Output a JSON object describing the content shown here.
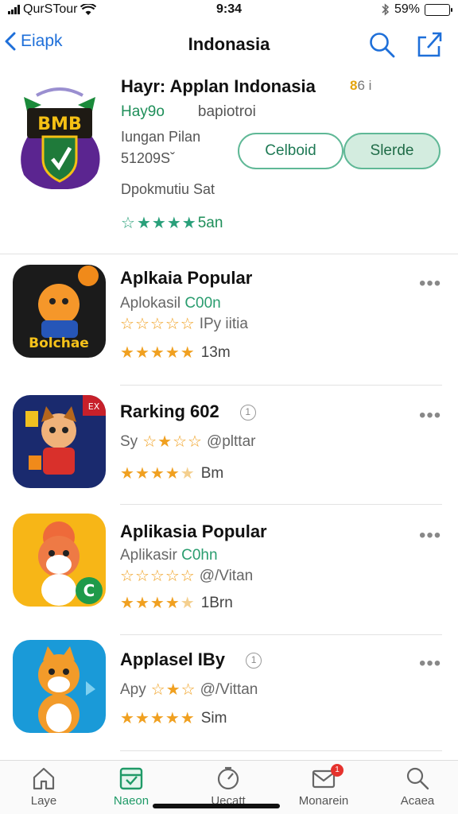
{
  "status_bar": {
    "carrier": "QurSTour",
    "time": "9:34",
    "battery": "59%",
    "battery_level": 0.59
  },
  "nav": {
    "back_label": "Eiapk",
    "title": "Indonasia"
  },
  "featured": {
    "title": "Hayr: Applan Indonasia",
    "badge_num": "8",
    "badge_text": "6 i",
    "developer": "Hay9o",
    "developer_sub": "bapiotroi",
    "meta_line1": "Iungan Pilan",
    "meta_line2": "51209Sˇ",
    "button_outline": "Celboid",
    "button_filled": "Slerde",
    "description": "Dpokmutiu  Sat",
    "rating_text": "5an",
    "rating_stars": 4
  },
  "items": [
    {
      "name": "Aplkaia Popular",
      "sub_prefix": "Aplokasil",
      "sub_accent": "C00n",
      "sub_stars_text": "IPy iitia",
      "rating_count": "13m",
      "stars": 5,
      "icon_text": "Bolchae"
    },
    {
      "name": "Rarking 602",
      "info": "1",
      "sub_prefix": "Sy",
      "sub_stars_text": "@plttar",
      "rating_count": "Bm",
      "stars": 4,
      "icon_badge": "EX"
    },
    {
      "name": "Aplikasia Popular",
      "sub_prefix": "Aplikasir",
      "sub_accent": "C0hn",
      "sub_stars_text": "@/Vitan",
      "rating_count": "1Brn",
      "stars": 4,
      "icon_badge": "C"
    },
    {
      "name": "Applasel IBy",
      "info": "1",
      "sub_prefix": "Apy",
      "sub_stars_text": "@/Vittan",
      "rating_count": "Sim",
      "stars": 5
    }
  ],
  "tabs": [
    {
      "label": "Laye",
      "icon": "home-icon"
    },
    {
      "label": "Naeon",
      "icon": "today-icon",
      "active": true
    },
    {
      "label": "Uecatt",
      "icon": "timer-icon"
    },
    {
      "label": "Monarein",
      "icon": "updates-icon",
      "badge": "1"
    },
    {
      "label": "Acaea",
      "icon": "search-icon"
    }
  ],
  "colors": {
    "accent_green": "#1f9a67",
    "link_blue": "#1e6fd9",
    "star_orange": "#f0a020",
    "star_teal": "#29a07a"
  }
}
